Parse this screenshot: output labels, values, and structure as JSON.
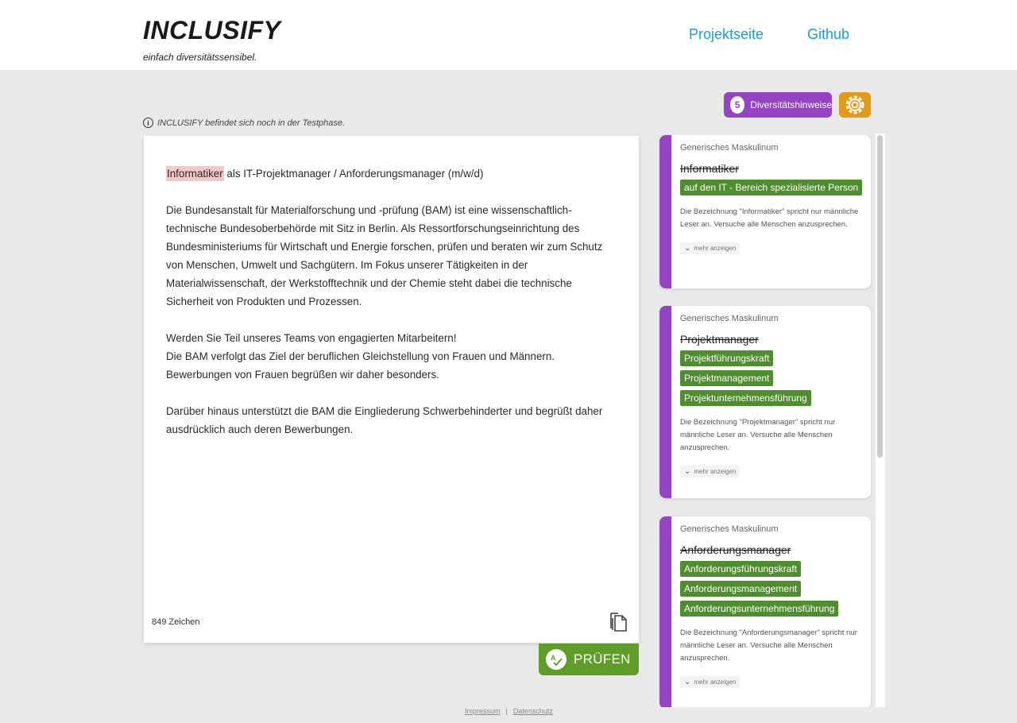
{
  "header": {
    "logo": "INCLUSIFY",
    "tagline": "einfach diversitätssensibel.",
    "nav": [
      {
        "label": "Projektseite"
      },
      {
        "label": "Github"
      }
    ]
  },
  "toolbar": {
    "hint_count": "5",
    "hint_label": "Diversitätshinweise",
    "settings_icon": "gear-icon"
  },
  "notice": "INCLUSIFY befindet sich noch in der Testphase.",
  "editor": {
    "highlight_word": "Informatiker",
    "title_rest": " als IT-Projektmanager / Anforderungsmanager (m/w/d)",
    "para1": "Die Bundesanstalt für Materialforschung und -prüfung (BAM) ist eine wissenschaftlich-technische Bundesoberbehörde mit Sitz in Berlin. Als Ressortforschungseinrichtung des Bundesministeriums für Wirtschaft und Energie forschen, prüfen und beraten wir zum Schutz von Menschen, Umwelt und Sachgütern. Im Fokus unserer Tätigkeiten in der Materialwissenschaft, der Werkstofftechnik und der Chemie steht dabei die technische Sicherheit von Produkten und Prozessen.",
    "para2_line1": "Werden Sie Teil unseres Teams von engagierten Mitarbeitern!",
    "para2_line2": "Die BAM verfolgt das Ziel der beruflichen Gleichstellung von Frauen und Männern.",
    "para2_line3": "Bewerbungen von Frauen begrüßen wir daher besonders.",
    "para3": "Darüber hinaus unterstützt die BAM die Eingliederung Schwerbehinderter und begrüßt daher ausdrücklich auch deren Bewerbungen.",
    "char_count": "849 Zeichen"
  },
  "check_button": "PRÜFEN",
  "cards": [
    {
      "category": "Generisches Maskulinum",
      "term": "Informatiker",
      "suggestions": [
        "auf den IT - Bereich spezialisierte Person"
      ],
      "description": "Die Bezeichnung \"Informatiker\" spricht nur männliche Leser an. Versuche alle Menschen anzusprechen.",
      "more": "mehr anzeigen"
    },
    {
      "category": "Generisches Maskulinum",
      "term": "Projektmanager",
      "suggestions": [
        "Projektführungskraft",
        "Projektmanagement",
        "Projektunternehmensführung"
      ],
      "description": "Die Bezeichnung \"Projektmanager\" spricht nur männliche Leser an. Versuche alle Menschen anzusprechen.",
      "more": "mehr anzeigen"
    },
    {
      "category": "Generisches Maskulinum",
      "term": "Anforderungsmanager",
      "suggestions": [
        "Anforderungsführungskraft",
        "Anforderungsmanagement",
        "Anforderungsunternehmensführung"
      ],
      "description": "Die Bezeichnung \"Anforderungsmanager\" spricht nur männliche Leser an. Versuche alle Menschen anzusprechen.",
      "more": "mehr anzeigen"
    }
  ],
  "footer": {
    "impressum": "Impressum",
    "separator": "|",
    "datenschutz": "Datenschutz"
  },
  "colors": {
    "accent_purple": "#9444c2",
    "accent_orange": "#e39a16",
    "suggestion_green": "#4f8e2e",
    "check_green": "#5e9e28",
    "link_blue": "#1a9fd0",
    "highlight": "#f4c6c6"
  }
}
